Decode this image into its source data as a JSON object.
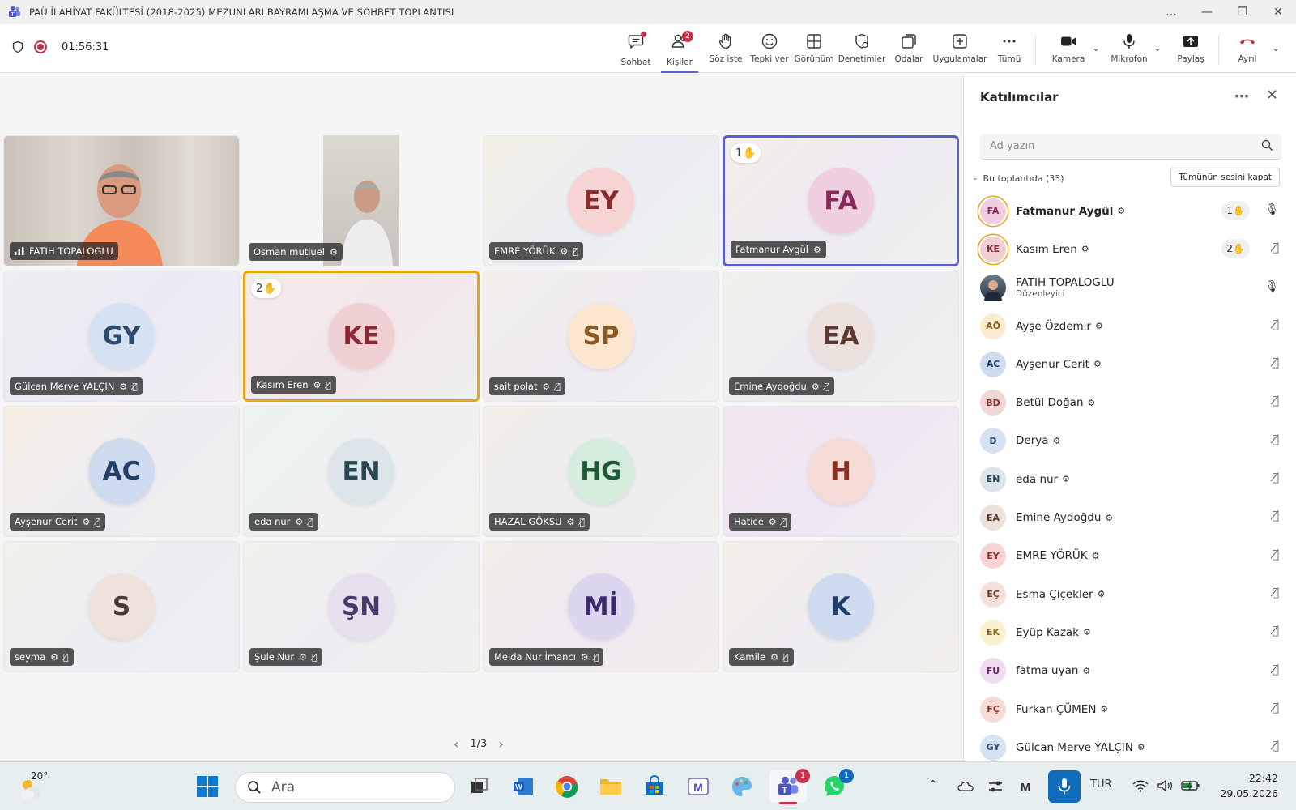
{
  "window": {
    "title": "PAÜ İLAHİYAT FAKÜLTESİ (2018-2025) MEZUNLARI BAYRAMLAŞMA VE SOHBET TOPLANTISI",
    "controls": [
      "…",
      "—",
      "❐",
      "✕"
    ]
  },
  "toolbar": {
    "timer": "01:56:31",
    "buttons": [
      {
        "label": "Sohbet"
      },
      {
        "label": "Kişiler",
        "badge": "2"
      },
      {
        "label": "Söz iste"
      },
      {
        "label": "Tepki ver"
      },
      {
        "label": "Görünüm"
      },
      {
        "label": "Denetimler"
      },
      {
        "label": "Odalar"
      },
      {
        "label": "Uygulamalar"
      },
      {
        "label": "Tümü"
      },
      {
        "label": "Kamera"
      },
      {
        "label": "Mikrofon"
      },
      {
        "label": "Paylaş"
      },
      {
        "label": "Ayrıl"
      }
    ]
  },
  "grid": {
    "tiles": [
      {
        "name": "FATIH TOPALOGLU",
        "initials": "",
        "video": true
      },
      {
        "name": "Osman mutluel",
        "initials": "",
        "video": true
      },
      {
        "name": "EMRE YÖRÜK",
        "initials": "EY"
      },
      {
        "name": "Fatmanur Aygül",
        "initials": "FA",
        "hand": "1"
      },
      {
        "name": "Gülcan Merve YALÇIN",
        "initials": "GY"
      },
      {
        "name": "Kasım Eren",
        "initials": "KE",
        "hand": "2"
      },
      {
        "name": "sait polat",
        "initials": "SP"
      },
      {
        "name": "Emine Aydoğdu",
        "initials": "EA"
      },
      {
        "name": "Ayşenur Cerit",
        "initials": "AC"
      },
      {
        "name": "eda nur",
        "initials": "EN"
      },
      {
        "name": "HAZAL GÖKSU",
        "initials": "HG"
      },
      {
        "name": "Hatice",
        "initials": "H"
      },
      {
        "name": "seyma",
        "initials": "S"
      },
      {
        "name": "Şule Nur",
        "initials": "ŞN"
      },
      {
        "name": "Melda Nur İmancı",
        "initials": "Mİ"
      },
      {
        "name": "Kamile",
        "initials": "K"
      }
    ],
    "pager": "1/3"
  },
  "participants": {
    "title": "Katılımcılar",
    "search_placeholder": "Ad yazın",
    "section_label": "Bu toplantıda (33)",
    "mute_all": "Tümünün sesini kapat",
    "list": [
      {
        "initials": "FA",
        "name": "Fatmanur Aygül",
        "hand": "1",
        "mic": "on"
      },
      {
        "initials": "KE",
        "name": "Kasım Eren",
        "hand": "2",
        "mic": "off"
      },
      {
        "initials": "",
        "name": "FATIH TOPALOGLU",
        "role": "Düzenleyici",
        "mic": "on"
      },
      {
        "initials": "AÖ",
        "name": "Ayşe Özdemir",
        "mic": "off"
      },
      {
        "initials": "AC",
        "name": "Ayşenur Cerit",
        "mic": "off"
      },
      {
        "initials": "BD",
        "name": "Betül Doğan",
        "mic": "off"
      },
      {
        "initials": "D",
        "name": "Derya",
        "mic": "off"
      },
      {
        "initials": "EN",
        "name": "eda nur",
        "mic": "off"
      },
      {
        "initials": "EA",
        "name": "Emine Aydoğdu",
        "mic": "off"
      },
      {
        "initials": "EY",
        "name": "EMRE YÖRÜK",
        "mic": "off"
      },
      {
        "initials": "EÇ",
        "name": "Esma Çiçekler",
        "mic": "off"
      },
      {
        "initials": "EK",
        "name": "Eyüp Kazak",
        "mic": "off"
      },
      {
        "initials": "FU",
        "name": "fatma uyan",
        "mic": "off"
      },
      {
        "initials": "FÇ",
        "name": "Furkan ÇÜMEN",
        "mic": "off"
      },
      {
        "initials": "GY",
        "name": "Gülcan Merve YALÇIN",
        "mic": "off"
      }
    ]
  },
  "taskbar": {
    "temperature": "20°",
    "search_label": "Ara",
    "teams_badge": "1",
    "whatsapp_badge": "1",
    "language": "TUR",
    "time": "22:42",
    "date": "29.05.2026"
  },
  "colors": {
    "accent": "#5b5fc7",
    "hand_highlight": "#e8a317",
    "leave_red": "#c4314b"
  }
}
